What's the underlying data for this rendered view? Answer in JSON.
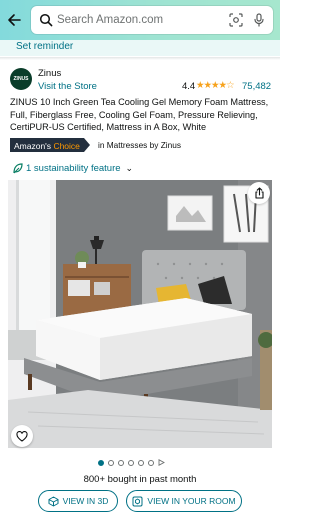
{
  "header": {
    "search_placeholder": "Search Amazon.com"
  },
  "reminder": {
    "label": "Set reminder"
  },
  "brand": {
    "logo_text": "ZINUS",
    "name": "Zinus",
    "visit_store": "Visit the Store"
  },
  "rating": {
    "value": "4.4",
    "stars": "★★★★☆",
    "count": "75,482"
  },
  "product": {
    "title": "ZINUS 10 Inch Green Tea Cooling Gel Memory Foam Mattress, Full, Fiberglass Free, Cooling Gel Foam, Pressure Relieving, CertiPUR-US Certified, Mattress in A Box, White"
  },
  "badge": {
    "prefix": "Amazon's",
    "accent": "Choice",
    "context": "in Mattresses by Zinus"
  },
  "sustainability": {
    "label": "1 sustainability feature"
  },
  "carousel": {
    "count": 7,
    "active_index": 0
  },
  "social_proof": {
    "bought_text": "800+ bought in past month"
  },
  "actions": {
    "view_3d": "VIEW IN 3D",
    "view_room": "VIEW IN YOUR ROOM"
  },
  "colors": {
    "link": "#007185",
    "header_start": "#83dadc",
    "header_end": "#a6e7ce",
    "star": "#f7a21b",
    "badge_bg": "#232f3e",
    "badge_accent": "#ff9900"
  },
  "icons": {
    "back": "arrow-left-icon",
    "search": "search-icon",
    "camera": "camera-scan-icon",
    "mic": "microphone-icon",
    "leaf": "leaf-icon",
    "share": "share-icon",
    "heart": "heart-icon",
    "cube": "cube-3d-icon",
    "room": "room-view-icon"
  }
}
